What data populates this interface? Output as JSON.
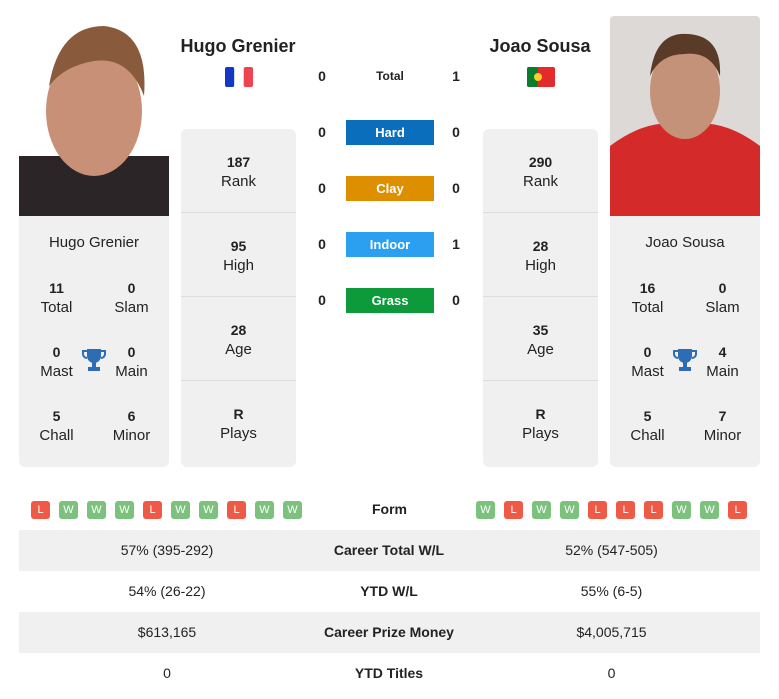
{
  "p1": {
    "name": "Hugo Grenier",
    "flag": "France",
    "total": "11",
    "slam": "0",
    "mast": "0",
    "main": "0",
    "chall": "5",
    "minor": "6",
    "rank": "187",
    "high": "95",
    "age": "28",
    "plays": "R",
    "form": [
      "L",
      "W",
      "W",
      "W",
      "L",
      "W",
      "W",
      "L",
      "W",
      "W"
    ]
  },
  "p2": {
    "name": "Joao Sousa",
    "flag": "Portugal",
    "total": "16",
    "slam": "0",
    "mast": "0",
    "main": "4",
    "chall": "5",
    "minor": "7",
    "rank": "290",
    "high": "28",
    "age": "35",
    "plays": "R",
    "form": [
      "W",
      "L",
      "W",
      "W",
      "L",
      "L",
      "L",
      "W",
      "W",
      "L"
    ]
  },
  "labels": {
    "total": "Total",
    "slam": "Slam",
    "mast": "Mast",
    "main": "Main",
    "chall": "Chall",
    "minor": "Minor",
    "rank": "Rank",
    "high": "High",
    "age": "Age",
    "plays": "Plays",
    "form": "Form"
  },
  "h2h": [
    {
      "label": "Total",
      "p1": "0",
      "p2": "1",
      "color": ""
    },
    {
      "label": "Hard",
      "p1": "0",
      "p2": "0",
      "color": "#0a6ebd"
    },
    {
      "label": "Clay",
      "p1": "0",
      "p2": "0",
      "color": "#dd8f00"
    },
    {
      "label": "Indoor",
      "p1": "0",
      "p2": "1",
      "color": "#2b9ff0"
    },
    {
      "label": "Grass",
      "p1": "0",
      "p2": "0",
      "color": "#0c9a3a"
    }
  ],
  "table": [
    {
      "label": "Career Total W/L",
      "p1": "57% (395-292)",
      "p2": "52% (547-505)"
    },
    {
      "label": "YTD W/L",
      "p1": "54% (26-22)",
      "p2": "55% (6-5)"
    },
    {
      "label": "Career Prize Money",
      "p1": "$613,165",
      "p2": "$4,005,715"
    },
    {
      "label": "YTD Titles",
      "p1": "0",
      "p2": "0"
    }
  ],
  "colors": {
    "win": "#7cc17e",
    "loss": "#ee5a45",
    "trophy": "#2e6db4"
  }
}
